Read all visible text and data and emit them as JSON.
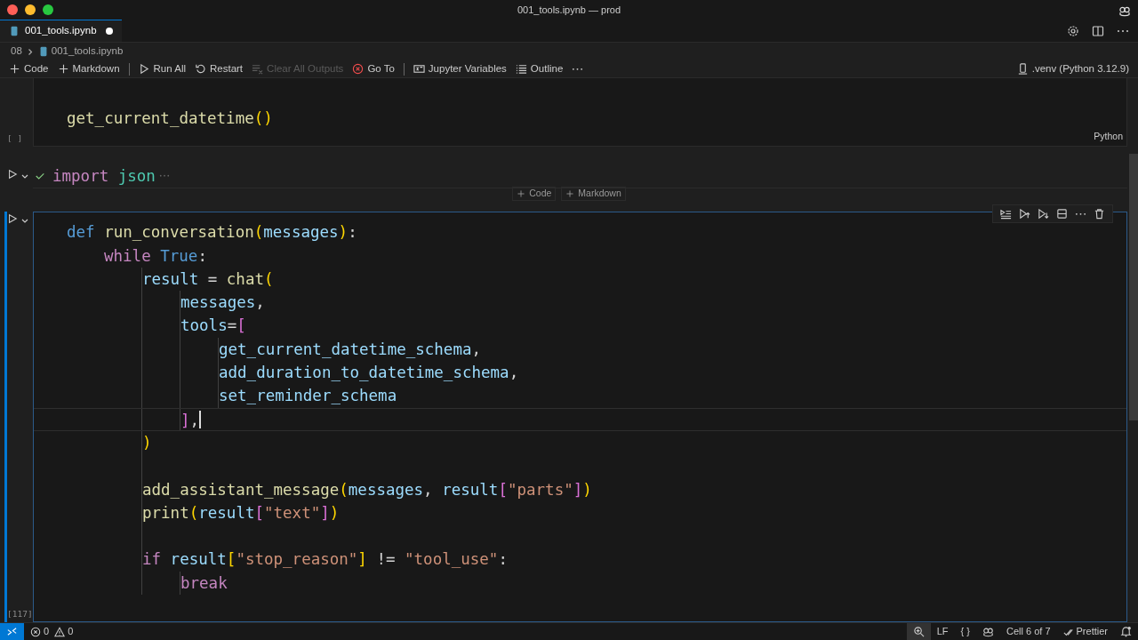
{
  "window": {
    "title": "001_tools.ipynb — prod"
  },
  "tabs": [
    {
      "label": "001_tools.ipynb",
      "selected": true,
      "modified": true
    }
  ],
  "breadcrumb": [
    "08",
    "001_tools.ipynb"
  ],
  "toolbar": [
    {
      "kind": "add",
      "label": "Code",
      "disabled": false
    },
    {
      "kind": "add",
      "label": "Markdown",
      "disabled": false
    },
    {
      "kind": "separator"
    },
    {
      "kind": "run_all",
      "label": "Run All",
      "disabled": false
    },
    {
      "kind": "restart",
      "label": "Restart",
      "disabled": false
    },
    {
      "kind": "clear",
      "label": "Clear All Outputs",
      "disabled": true
    },
    {
      "kind": "goto",
      "label": "Go To",
      "disabled": false
    },
    {
      "kind": "separator"
    },
    {
      "kind": "variables",
      "label": "Jupyter Variables",
      "disabled": false
    },
    {
      "kind": "outline",
      "label": "Outline",
      "disabled": false
    },
    {
      "kind": "more"
    }
  ],
  "kernel": ".venv (Python 3.12.9)",
  "cells": [
    {
      "kind": "code",
      "execution_count": "[ ]",
      "language": "Python",
      "focused": false,
      "lines": [
        {
          "current": false,
          "tokens": [
            {
              "text": "get_current_datetime",
              "kind": "func"
            },
            {
              "text": "()",
              "kind": "bracket1"
            }
          ]
        }
      ]
    },
    {
      "kind": "collapsed",
      "succeeded": true,
      "lines": [
        {
          "current": false,
          "tokens": [
            {
              "text": "import ",
              "kind": "control"
            },
            {
              "text": "json",
              "kind": "module"
            }
          ]
        }
      ]
    },
    {
      "kind": "insert",
      "buttons": [
        "Code",
        "Markdown"
      ]
    },
    {
      "kind": "code",
      "execution_count": "[117]",
      "focused": true,
      "lines": [
        {
          "current": false,
          "tokens": [
            {
              "text": "def ",
              "kind": "keyword"
            },
            {
              "text": "run_conversation",
              "kind": "func"
            },
            {
              "text": "(",
              "kind": "bracket1"
            },
            {
              "text": "messages",
              "kind": "var"
            },
            {
              "text": ")",
              "kind": "bracket1"
            },
            {
              "text": ":",
              "kind": "plain"
            }
          ],
          "children": [
            {
              "current": false,
              "tokens": [
                {
                  "text": "while ",
                  "kind": "control"
                },
                {
                  "text": "True",
                  "kind": "keyword"
                },
                {
                  "text": ":",
                  "kind": "plain"
                }
              ],
              "children": [
                {
                  "current": false,
                  "tokens": [
                    {
                      "text": "result",
                      "kind": "var"
                    },
                    {
                      "text": " = ",
                      "kind": "plain"
                    },
                    {
                      "text": "chat",
                      "kind": "func"
                    },
                    {
                      "text": "(",
                      "kind": "bracket1"
                    }
                  ],
                  "children": [
                    {
                      "current": false,
                      "tokens": [
                        {
                          "text": "messages",
                          "kind": "var"
                        },
                        {
                          "text": ",",
                          "kind": "plain"
                        }
                      ]
                    },
                    {
                      "current": false,
                      "tokens": [
                        {
                          "text": "tools",
                          "kind": "var"
                        },
                        {
                          "text": "=",
                          "kind": "plain"
                        },
                        {
                          "text": "[",
                          "kind": "bracket2"
                        }
                      ],
                      "children": [
                        {
                          "current": false,
                          "tokens": [
                            {
                              "text": "get_current_datetime_schema",
                              "kind": "var"
                            },
                            {
                              "text": ",",
                              "kind": "plain"
                            }
                          ]
                        },
                        {
                          "current": false,
                          "tokens": [
                            {
                              "text": "add_duration_to_datetime_schema",
                              "kind": "var"
                            },
                            {
                              "text": ",",
                              "kind": "plain"
                            }
                          ]
                        },
                        {
                          "current": false,
                          "tokens": [
                            {
                              "text": "set_reminder_schema",
                              "kind": "var"
                            }
                          ]
                        }
                      ]
                    },
                    {
                      "current": true,
                      "tokens": [
                        {
                          "text": "]",
                          "kind": "bracket2"
                        },
                        {
                          "text": ",",
                          "kind": "plain"
                        }
                      ]
                    }
                  ]
                },
                {
                  "current": false,
                  "tokens": [
                    {
                      "text": ")",
                      "kind": "bracket1"
                    }
                  ]
                },
                {
                  "current": false
                },
                {
                  "current": false,
                  "tokens": [
                    {
                      "text": "add_assistant_message",
                      "kind": "func"
                    },
                    {
                      "text": "(",
                      "kind": "bracket1"
                    },
                    {
                      "text": "messages",
                      "kind": "var"
                    },
                    {
                      "text": ", ",
                      "kind": "plain"
                    },
                    {
                      "text": "result",
                      "kind": "var"
                    },
                    {
                      "text": "[",
                      "kind": "bracket2"
                    },
                    {
                      "text": "\"parts\"",
                      "kind": "string"
                    },
                    {
                      "text": "]",
                      "kind": "bracket2"
                    },
                    {
                      "text": ")",
                      "kind": "bracket1"
                    }
                  ]
                },
                {
                  "current": false,
                  "tokens": [
                    {
                      "text": "print",
                      "kind": "func"
                    },
                    {
                      "text": "(",
                      "kind": "bracket1"
                    },
                    {
                      "text": "result",
                      "kind": "var"
                    },
                    {
                      "text": "[",
                      "kind": "bracket2"
                    },
                    {
                      "text": "\"text\"",
                      "kind": "string"
                    },
                    {
                      "text": "]",
                      "kind": "bracket2"
                    },
                    {
                      "text": ")",
                      "kind": "bracket1"
                    }
                  ]
                },
                {
                  "current": false
                },
                {
                  "current": false,
                  "tokens": [
                    {
                      "text": "if ",
                      "kind": "control"
                    },
                    {
                      "text": "result",
                      "kind": "var"
                    },
                    {
                      "text": "[",
                      "kind": "bracket1"
                    },
                    {
                      "text": "\"stop_reason\"",
                      "kind": "string"
                    },
                    {
                      "text": "]",
                      "kind": "bracket1"
                    },
                    {
                      "text": " != ",
                      "kind": "plain"
                    },
                    {
                      "text": "\"tool_use\"",
                      "kind": "string"
                    },
                    {
                      "text": ":",
                      "kind": "plain"
                    }
                  ],
                  "children": [
                    {
                      "current": false,
                      "tokens": [
                        {
                          "text": "break",
                          "kind": "control"
                        }
                      ]
                    }
                  ]
                }
              ]
            }
          ]
        }
      ]
    }
  ],
  "status_bar": {
    "errors": "0",
    "warnings": "0",
    "items": [
      {
        "kind": "zoom",
        "active": true
      },
      {
        "kind": "text",
        "label": "LF"
      },
      {
        "kind": "text",
        "label": "{ }"
      },
      {
        "kind": "copilot"
      },
      {
        "kind": "text",
        "label": "Cell 6 of 7"
      },
      {
        "kind": "prettier",
        "label": "Prettier"
      },
      {
        "kind": "bell"
      }
    ]
  }
}
